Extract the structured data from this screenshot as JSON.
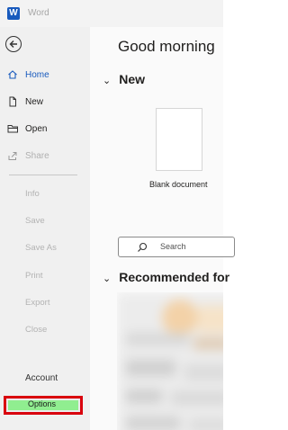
{
  "titlebar": {
    "app_name": "Word",
    "icon": "word-icon"
  },
  "sidebar": {
    "back_icon": "back-arrow-icon",
    "primary": [
      {
        "label": "Home",
        "icon": "home-icon",
        "active": true
      },
      {
        "label": "New",
        "icon": "new-document-icon",
        "active": false
      },
      {
        "label": "Open",
        "icon": "open-folder-icon",
        "active": false
      },
      {
        "label": "Share",
        "icon": "share-icon",
        "active": false,
        "disabled": true
      }
    ],
    "secondary": [
      "Info",
      "Save",
      "Save As",
      "Print",
      "Export",
      "Close"
    ],
    "account_label": "Account",
    "options_label": "Options",
    "highlight_color": "#d9000d"
  },
  "main": {
    "greeting": "Good morning",
    "new_section_title": "New",
    "blank_document_label": "Blank document",
    "search_placeholder": "Search",
    "recommended_title": "Recommended for"
  },
  "colors": {
    "accent": "#185abd",
    "sidebar_bg": "#f0f0f0",
    "main_bg": "#fafafa",
    "options_fill": "#90ee90"
  }
}
